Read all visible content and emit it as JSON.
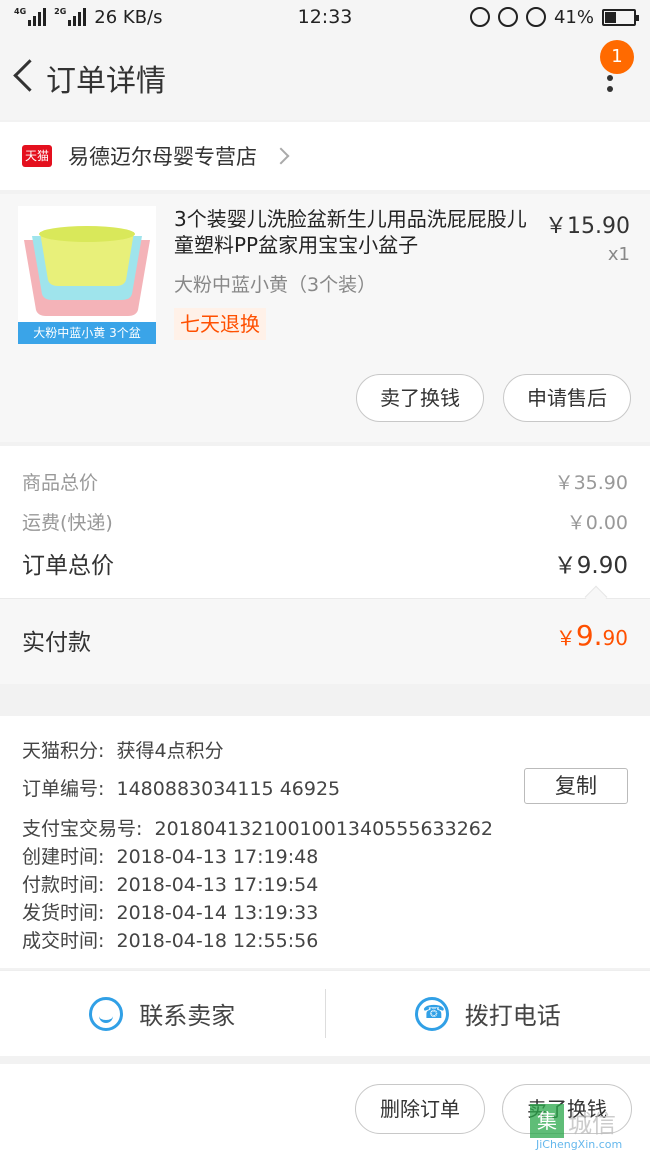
{
  "status_bar": {
    "network": "4G",
    "network2": "2G",
    "speed": "26 KB/s",
    "time": "12:33",
    "battery": "41%",
    "battery_level": 0.41
  },
  "header": {
    "title": "订单详情",
    "badge": "1"
  },
  "shop": {
    "badge": "天猫",
    "name": "易德迈尔母婴专营店"
  },
  "product": {
    "thumb_caption": "大粉中蓝小黄 3个盆",
    "name": "3个装婴儿洗脸盆新生儿用品洗屁屁股儿童塑料PP盆家用宝宝小盆子",
    "price": "￥15.90",
    "qty": "x1",
    "sku": "大粉中蓝小黄（3个装）",
    "tag": "七天退换",
    "btn_sell": "卖了换钱",
    "btn_after_sale": "申请售后"
  },
  "summary": {
    "goods_label": "商品总价",
    "goods_value": "￥35.90",
    "ship_label": "运费(快递)",
    "ship_value": "￥0.00",
    "total_label": "订单总价",
    "total_value": "￥9.90",
    "paid_label": "实付款",
    "paid_currency": "￥",
    "paid_int": "9.",
    "paid_dec": "90"
  },
  "info": {
    "points_label": "天猫积分:",
    "points_value": "获得4点积分",
    "order_label": "订单编号:",
    "order_value": "1480883034115 46925",
    "copy_label": "复制",
    "alipay_label": "支付宝交易号:",
    "alipay_value": "2018041321001001340555633262",
    "created_label": "创建时间:",
    "created_value": "2018-04-13 17:19:48",
    "paid_label": "付款时间:",
    "paid_value": "2018-04-13 17:19:54",
    "shipped_label": "发货时间:",
    "shipped_value": "2018-04-14 13:19:33",
    "done_label": "成交时间:",
    "done_value": "2018-04-18 12:55:56"
  },
  "contact": {
    "seller_label": "联系卖家",
    "call_label": "拨打电话"
  },
  "bottom": {
    "delete_label": "删除订单",
    "sell_label": "卖了换钱"
  },
  "watermark": {
    "box": "集",
    "cn": "城信",
    "en": "JiChengXin.com"
  },
  "colors": {
    "accent": "#ff5000",
    "blue": "#31a0e6",
    "badge": "#ff6a00",
    "tmall": "#e4101e"
  }
}
